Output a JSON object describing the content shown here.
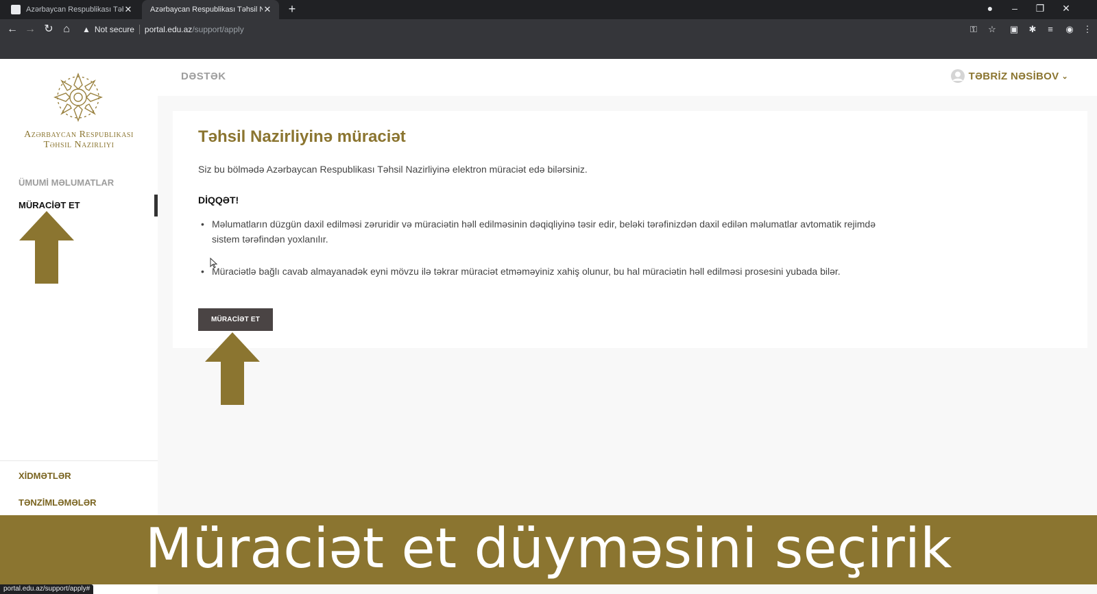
{
  "browser": {
    "tabs": [
      {
        "title": "Azərbaycan Respublikası Təhsil N",
        "close": "✕"
      },
      {
        "title": "Azərbaycan Respublikası Təhsil N",
        "close": "✕"
      }
    ],
    "new_tab": "+",
    "address": {
      "security": "Not secure",
      "host": "portal.edu.az",
      "path": "/support/apply"
    },
    "status_url": "portal.edu.az/support/apply#"
  },
  "sidebar": {
    "logo_line1": "Azərbaycan Respublikası",
    "logo_line2": "Təhsil Nazirliyi",
    "nav": {
      "general": "ÜMUMİ MƏLUMATLAR",
      "apply": "MÜRACİƏT ET",
      "services": "XİDMƏTLƏR",
      "settings": "TƏNZİMLƏMƏLƏR"
    }
  },
  "header": {
    "section": "DƏSTƏK",
    "user_name": "TƏBRİZ NƏSİBOV"
  },
  "main": {
    "title": "Təhsil Nazirliyinə müraciət",
    "intro": "Siz bu bölmədə Azərbaycan Respublikası Təhsil Nazirliyinə elektron müraciət edə bilərsiniz.",
    "attention": "DİQQƏT!",
    "bullets": [
      "Məlumatların düzgün daxil edilməsi zəruridir və müraciətin həll edilməsinin dəqiqliyinə təsir edir, beləki tərəfinizdən daxil edilən məlumatlar avtomatik rejimdə sistem tərəfindən yoxlanılır.",
      "Müraciətlə bağlı cavab almayanadək eyni mövzu ilə təkrar müraciət etməməyiniz xahiş olunur, bu hal müraciətin həll edilməsi prosesini yubada bilər."
    ],
    "apply_button": "MÜRACİƏT ET"
  },
  "caption": "Müraciət et düyməsini seçirik",
  "colors": {
    "brand_gold": "#8b7530",
    "button_dark": "#4a4444"
  }
}
